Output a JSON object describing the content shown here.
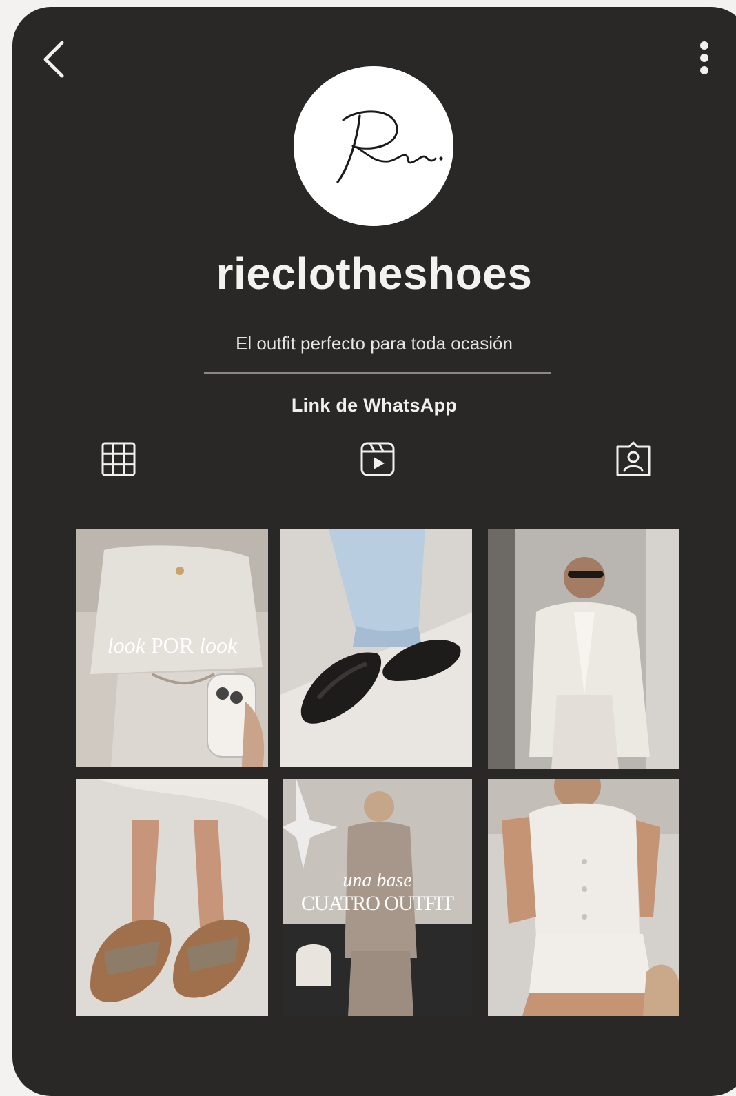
{
  "profile": {
    "avatar_text": "Rie.",
    "username": "rieclotheshoes",
    "bio": "El outfit perfecto para toda ocasión",
    "link_label": "Link de WhatsApp"
  },
  "icons": {
    "back": "chevron-left-icon",
    "more": "more-vertical-icon",
    "grid_tab": "grid-icon",
    "reels_tab": "reels-icon",
    "tagged_tab": "tagged-person-icon"
  },
  "posts": [
    {
      "overlay_script": "look",
      "overlay_main": "POR",
      "overlay_script_2": "look"
    },
    {},
    {},
    {},
    {
      "overlay_script": "una base",
      "overlay_main": "CUATRO OUTFIT"
    },
    {}
  ],
  "colors": {
    "background": "#2a2826",
    "text": "#f4f2ef",
    "divider": "#8b8883"
  }
}
